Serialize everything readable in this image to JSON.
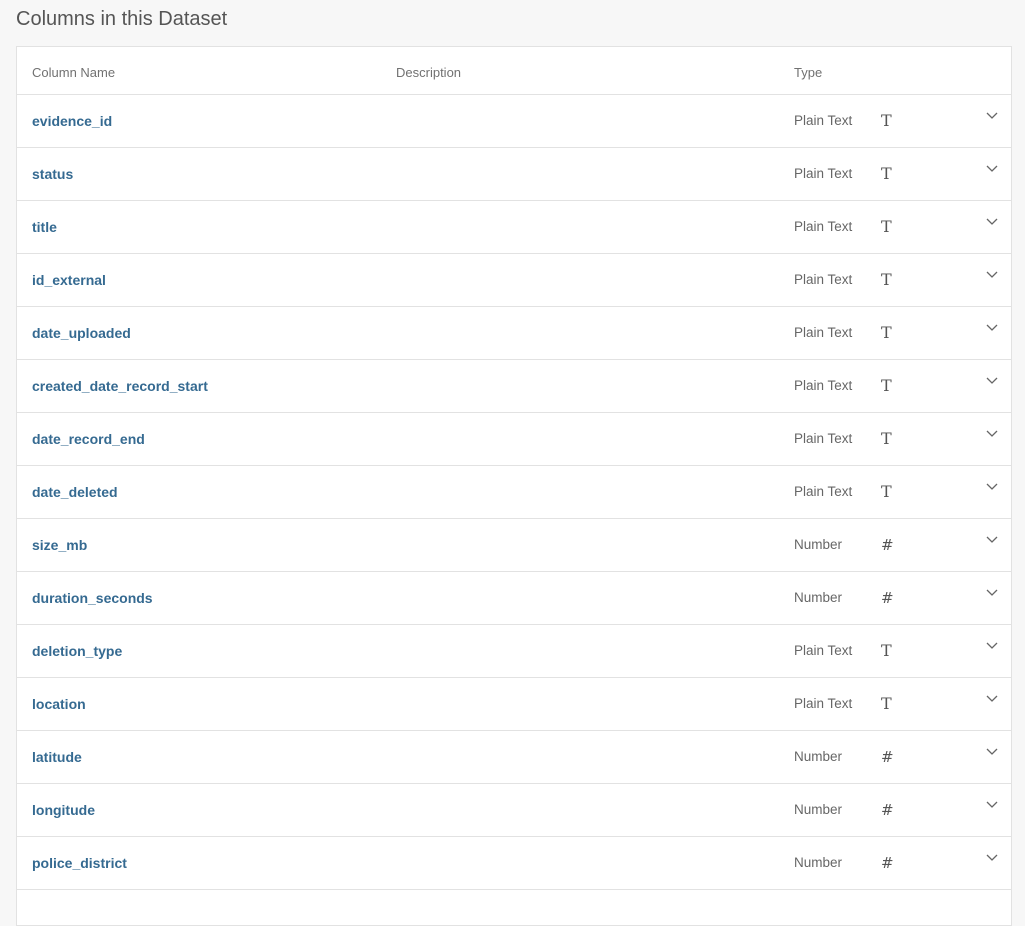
{
  "section_title": "Columns in this Dataset",
  "table": {
    "headers": {
      "column_name": "Column Name",
      "description": "Description",
      "type": "Type"
    },
    "rows": [
      {
        "name": "evidence_id",
        "description": "",
        "type": "Plain Text",
        "type_icon": "T"
      },
      {
        "name": "status",
        "description": "",
        "type": "Plain Text",
        "type_icon": "T"
      },
      {
        "name": "title",
        "description": "",
        "type": "Plain Text",
        "type_icon": "T"
      },
      {
        "name": "id_external",
        "description": "",
        "type": "Plain Text",
        "type_icon": "T"
      },
      {
        "name": "date_uploaded",
        "description": "",
        "type": "Plain Text",
        "type_icon": "T"
      },
      {
        "name": "created_date_record_start",
        "description": "",
        "type": "Plain Text",
        "type_icon": "T"
      },
      {
        "name": "date_record_end",
        "description": "",
        "type": "Plain Text",
        "type_icon": "T"
      },
      {
        "name": "date_deleted",
        "description": "",
        "type": "Plain Text",
        "type_icon": "T"
      },
      {
        "name": "size_mb",
        "description": "",
        "type": "Number",
        "type_icon": "#"
      },
      {
        "name": "duration_seconds",
        "description": "",
        "type": "Number",
        "type_icon": "#"
      },
      {
        "name": "deletion_type",
        "description": "",
        "type": "Plain Text",
        "type_icon": "T"
      },
      {
        "name": "location",
        "description": "",
        "type": "Plain Text",
        "type_icon": "T"
      },
      {
        "name": "latitude",
        "description": "",
        "type": "Number",
        "type_icon": "#"
      },
      {
        "name": "longitude",
        "description": "",
        "type": "Number",
        "type_icon": "#"
      },
      {
        "name": "police_district",
        "description": "",
        "type": "Number",
        "type_icon": "#"
      }
    ]
  },
  "colors": {
    "column_name": "#356a91",
    "border": "#e2e2e2",
    "background": "#f7f7f7"
  },
  "icons": {
    "plain_text": "plain-text-type-icon",
    "number": "number-type-icon",
    "expand": "chevron-down-icon"
  }
}
